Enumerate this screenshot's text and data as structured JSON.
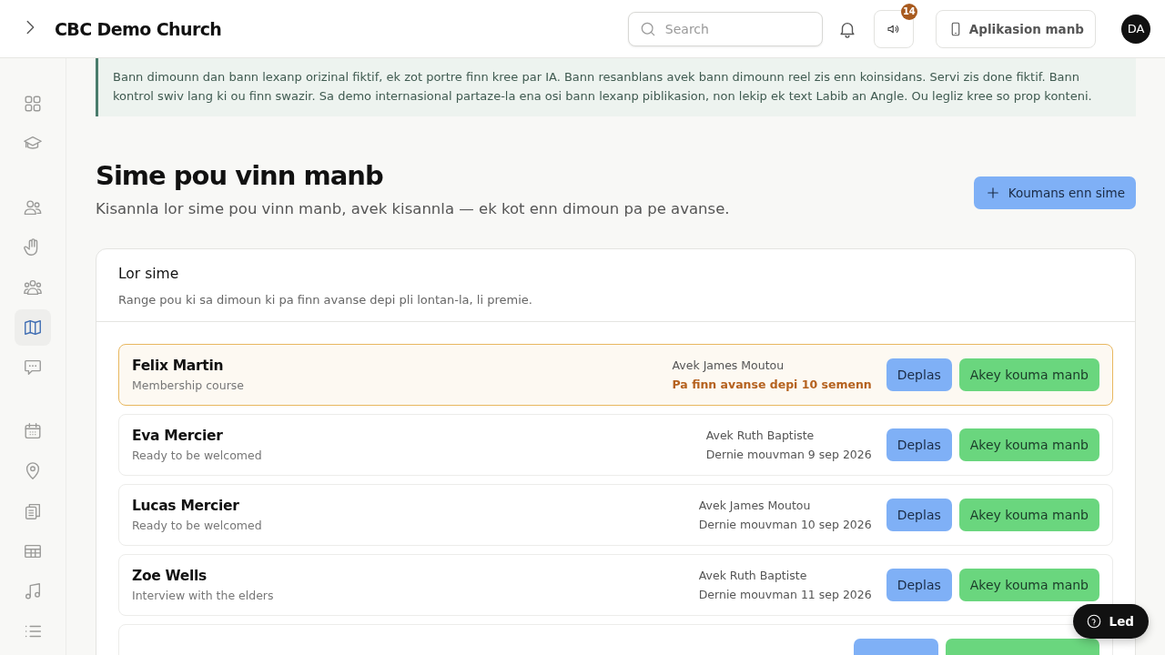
{
  "header": {
    "title": "CBC Demo Church",
    "search": {
      "placeholder": "Search"
    },
    "announcement_badge": "14",
    "app_button": "Aplikasion manb",
    "avatar": "DA"
  },
  "sidebar": {
    "groups": [
      [
        {
          "selected": false
        },
        {
          "selected": false
        }
      ],
      [
        {
          "selected": false
        },
        {
          "selected": false
        },
        {
          "selected": false
        },
        {
          "selected": true
        },
        {
          "selected": false
        }
      ],
      [
        {
          "selected": false
        },
        {
          "selected": false
        },
        {
          "selected": false
        },
        {
          "selected": false
        },
        {
          "selected": false
        },
        {
          "selected": false
        }
      ]
    ]
  },
  "notice": "Bann dimounn dan bann lexanp orizinal fiktif, ek zot portre finn kree par IA. Bann resanblans avek bann dimounn reel zis enn koinsidans. Servi zis done fiktif. Bann kontrol swiv lang ki ou finn swazir. Sa demo internasional partaze-la ena osi bann lexanp piblikasion, non lekip ek text Labib an Angle. Ou legliz kree so prop konteni.",
  "page": {
    "title": "Sime pou vinn manb",
    "subtitle": "Kisannla lor sime pou vinn manb, avek kisannla — ek kot enn dimoun pa pe avanse.",
    "add_button": "Koumans enn sime"
  },
  "panel": {
    "title": "Lor sime",
    "subtitle": "Range pou ki sa dimoun ki pa finn avanse depi pli lontan-la, li premie.",
    "rows": [
      {
        "name": "Felix Martin",
        "step": "Membership course",
        "mentor": "Avek James Moutou",
        "status": "Pa finn avanse depi 10 semenn",
        "stalled": true,
        "actions": [
          "Deplas",
          "Akey kouma manb"
        ]
      },
      {
        "name": "Eva Mercier",
        "step": "Ready to be welcomed",
        "mentor": "Avek Ruth Baptiste",
        "status": "Dernie mouvman 9 sep 2026",
        "stalled": false,
        "actions": [
          "Deplas",
          "Akey kouma manb"
        ]
      },
      {
        "name": "Lucas Mercier",
        "step": "Ready to be welcomed",
        "mentor": "Avek James Moutou",
        "status": "Dernie mouvman 10 sep 2026",
        "stalled": false,
        "actions": [
          "Deplas",
          "Akey kouma manb"
        ]
      },
      {
        "name": "Zoe Wells",
        "step": "Interview with the elders",
        "mentor": "Avek Ruth Baptiste",
        "status": "Dernie mouvman 11 sep 2026",
        "stalled": false,
        "actions": [
          "Deplas",
          "Akey kouma manb"
        ]
      }
    ]
  },
  "help_button": "Led"
}
